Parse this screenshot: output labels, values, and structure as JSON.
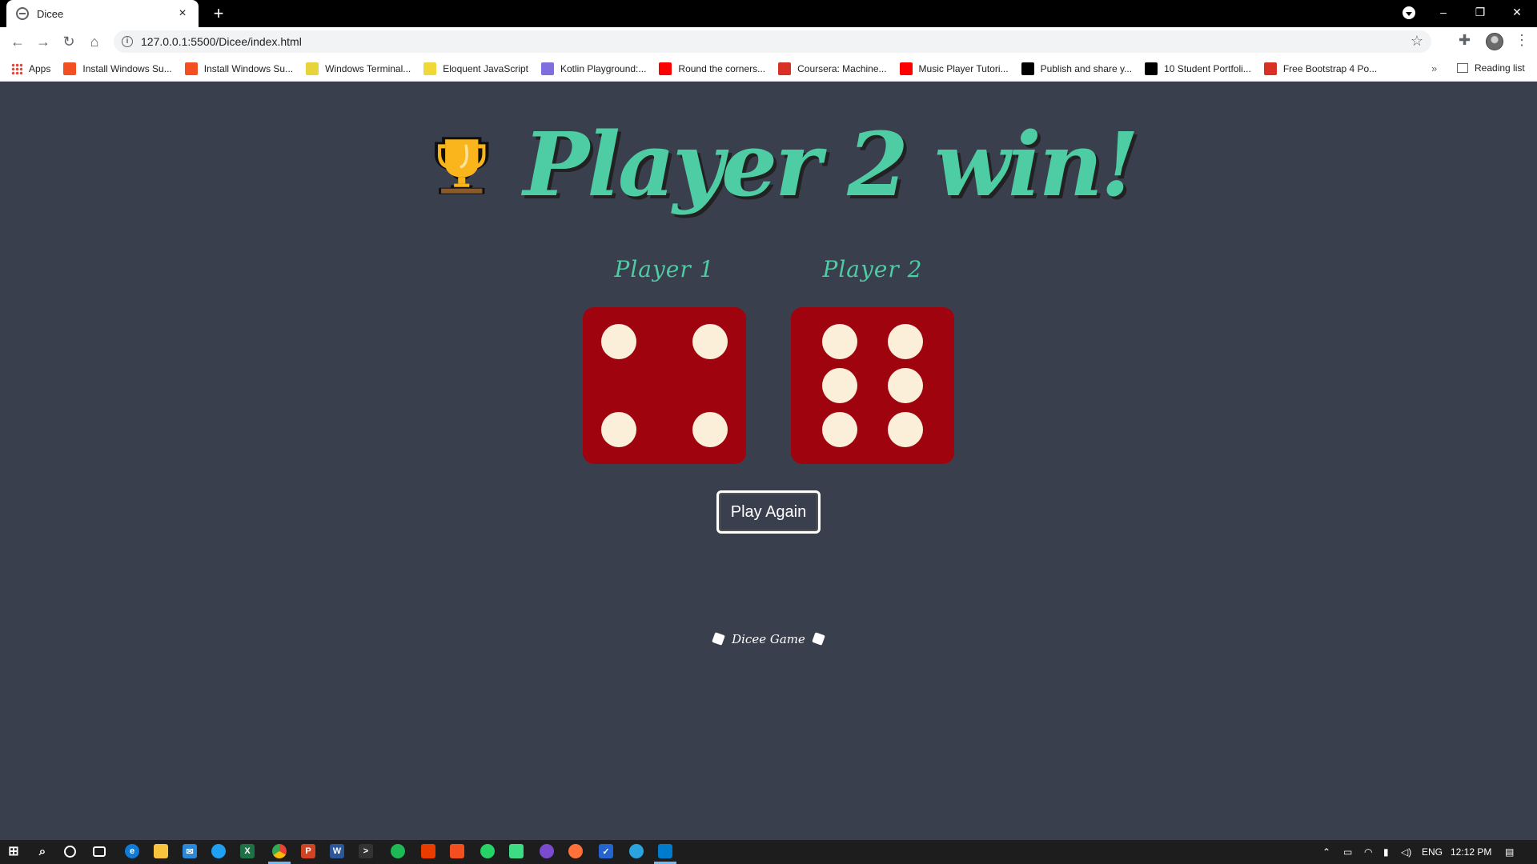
{
  "browser": {
    "tab_title": "Dicee",
    "tab_close": "×",
    "new_tab": "+",
    "url": "127.0.0.1:5500/Dicee/index.html",
    "window_controls": {
      "minimize": "–",
      "restore": "❐",
      "close": "✕"
    }
  },
  "bookmarks": {
    "apps_label": "Apps",
    "items": [
      {
        "label": "Install Windows Su...",
        "icon": "windows-icon",
        "color": "#f25022"
      },
      {
        "label": "Install Windows Su...",
        "icon": "windows-icon",
        "color": "#f25022"
      },
      {
        "label": "Windows Terminal...",
        "icon": "terminal-icon",
        "color": "#e8d43a"
      },
      {
        "label": "Eloquent JavaScript",
        "icon": "js-icon",
        "color": "#f0d83a"
      },
      {
        "label": "Kotlin Playground:...",
        "icon": "kotlin-icon",
        "color": "#7f6fdc"
      },
      {
        "label": "Round the corners...",
        "icon": "youtube-icon",
        "color": "#ff0000"
      },
      {
        "label": "Coursera: Machine...",
        "icon": "coursera-icon",
        "color": "#d93025"
      },
      {
        "label": "Music Player Tutori...",
        "icon": "youtube-icon",
        "color": "#ff0000"
      },
      {
        "label": "Publish and share y...",
        "icon": "medium-icon",
        "color": "#000000"
      },
      {
        "label": "10 Student Portfoli...",
        "icon": "dev-icon",
        "color": "#000000"
      },
      {
        "label": "Free Bootstrap 4 Po...",
        "icon": "s-icon",
        "color": "#d93025"
      }
    ],
    "more": "»",
    "reading_list": "Reading list"
  },
  "game": {
    "title": "Player 2 win!",
    "player1_label": "Player 1",
    "player2_label": "Player 2",
    "player1_die_value": 4,
    "player2_die_value": 6,
    "button_label": "Play Again",
    "footer_text": "Dicee Game"
  },
  "colors": {
    "background": "#393f4d",
    "accent": "#4ecca3",
    "die": "#9e030e",
    "pip": "#fcefd9"
  },
  "taskbar": {
    "language": "ENG",
    "time": "12:12 PM"
  }
}
